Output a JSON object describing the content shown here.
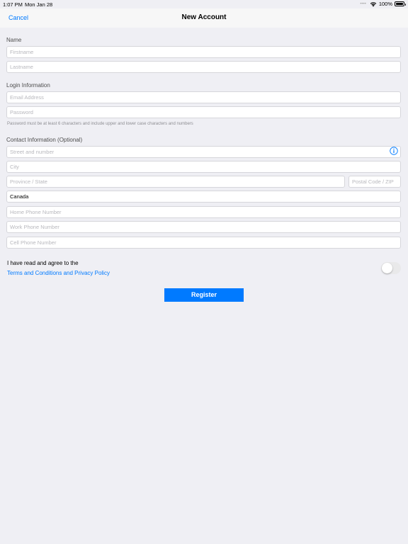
{
  "status_bar": {
    "time": "1:07 PM",
    "date": "Mon Jan 28",
    "battery": "100%"
  },
  "nav": {
    "cancel_label": "Cancel",
    "title": "New Account"
  },
  "sections": {
    "name": "Name",
    "login": "Login Information",
    "contact": "Contact Information (Optional)"
  },
  "fields": {
    "firstname_placeholder": "Firstname",
    "lastname_placeholder": "Lastname",
    "email_placeholder": "Email Address",
    "password_placeholder": "Password",
    "street_placeholder": "Street and number",
    "city_placeholder": "City",
    "province_placeholder": "Province / State",
    "postal_placeholder": "Postal Code / ZIP",
    "country_value": "Canada",
    "home_phone_placeholder": "Home Phone Number",
    "work_phone_placeholder": "Work Phone Number",
    "cell_phone_placeholder": "Cell Phone Number"
  },
  "password_hint": "Password must be at least 6 characters and include upper and lower case characters and numbers",
  "agreement": {
    "text": "I have read and agree to the",
    "link": "Terms and Conditions and Privacy Policy",
    "toggle_on": false
  },
  "register_label": "Register",
  "colors": {
    "accent": "#007aff",
    "background": "#efeff4"
  }
}
